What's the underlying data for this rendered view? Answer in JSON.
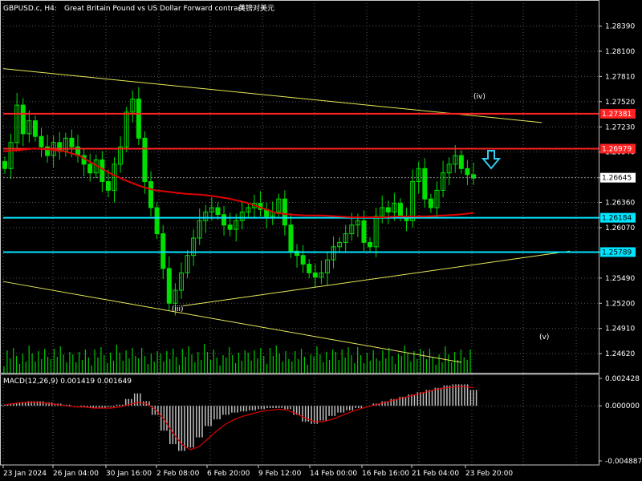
{
  "header": {
    "symbol_timeframe": "GBPUSD.c, H4:",
    "description": "Great Britain Pound vs US Dollar Forward contract",
    "description_cn": "英镑对美元"
  },
  "macd_label": "MACD(12,26,9) 0.001419 0.001649",
  "colors": {
    "background": "#000000",
    "grid": "#5a5a5a",
    "axis": "#c8c8c8",
    "candle": "#00e000",
    "volume": "#00c800",
    "ma_line": "#e00000",
    "resistance": "#ff2222",
    "support": "#00e5ff",
    "trendline": "#e8e85a",
    "macd_hist": "#c0c0c0",
    "macd_signal": "#e00000",
    "arrow": "#33ccee"
  },
  "chart_data": {
    "type": "candlestick",
    "symbol": "GBPUSD.c",
    "timeframe": "H4",
    "price_ylim": [
      1.244,
      1.2869
    ],
    "price_ticks": [
      "1.28390",
      "1.28100",
      "1.27810",
      "1.27520",
      "1.27230",
      "1.26940",
      "1.26645",
      "1.26360",
      "1.26184",
      "1.26070",
      "1.25789",
      "1.25490",
      "1.25200",
      "1.24910",
      "1.24620"
    ],
    "x_tick_labels": [
      "23 Jan 2024",
      "26 Jan 04:00",
      "30 Jan 16:00",
      "2 Feb 08:00",
      "6 Feb 20:00",
      "9 Feb 12:00",
      "14 Feb 00:00",
      "16 Feb 16:00",
      "21 Feb 04:00",
      "23 Feb 20:00"
    ],
    "close_series": [
      1.2675,
      1.2705,
      1.2748,
      1.2715,
      1.273,
      1.2712,
      1.27,
      1.269,
      1.2705,
      1.2695,
      1.271,
      1.27,
      1.269,
      1.268,
      1.267,
      1.2685,
      1.266,
      1.265,
      1.268,
      1.27,
      1.274,
      1.2755,
      1.271,
      1.266,
      1.263,
      1.26,
      1.256,
      1.252,
      1.2535,
      1.2555,
      1.2575,
      1.2595,
      1.2615,
      1.2625,
      1.263,
      1.2622,
      1.261,
      1.2605,
      1.2615,
      1.2625,
      1.263,
      1.2635,
      1.2628,
      1.262,
      1.2625,
      1.264,
      1.261,
      1.258,
      1.2575,
      1.2565,
      1.2555,
      1.255,
      1.2555,
      1.257,
      1.2585,
      1.259,
      1.26,
      1.261,
      1.2615,
      1.259,
      1.2585,
      1.262,
      1.263,
      1.2625,
      1.2635,
      1.262,
      1.2615,
      1.266,
      1.2675,
      1.264,
      1.263,
      1.265,
      1.267,
      1.268,
      1.269,
      1.2675,
      1.2668,
      1.2664
    ],
    "ma_series": [
      1.2695,
      1.2696,
      1.2698,
      1.2697,
      1.2695,
      1.269,
      1.268,
      1.267,
      1.2662,
      1.2655,
      1.265,
      1.2648,
      1.2646,
      1.2645,
      1.2643,
      1.264,
      1.2636,
      1.263,
      1.2624,
      1.2622,
      1.2621,
      1.2621,
      1.262,
      1.2619,
      1.2619,
      1.2619,
      1.262,
      1.262,
      1.262,
      1.2621,
      1.2622,
      1.2624
    ],
    "horizontal_levels": [
      {
        "name": "resistance",
        "value": 1.27381,
        "label": "1.27381"
      },
      {
        "name": "resistance",
        "value": 1.26979,
        "label": "1.26979"
      },
      {
        "name": "support",
        "value": 1.26184,
        "label": "1.26184"
      },
      {
        "name": "support",
        "value": 1.25789,
        "label": "1.25789"
      }
    ],
    "current_price": 1.26645,
    "current_price_label": "1.26645",
    "wave_labels": [
      "(iv)",
      "(iii)",
      "(v)"
    ],
    "macd": {
      "params": "12,26,9",
      "main": 0.001419,
      "signal": 0.001649,
      "ylim": [
        -0.004887,
        0.002428
      ],
      "ticks": [
        "0.002428",
        "0.000000",
        "-0.004887"
      ],
      "hist": [
        0.0001,
        0.0002,
        0.0003,
        0.0004,
        0.0004,
        0.0003,
        0.0002,
        0.0001,
        0.0,
        -0.0001,
        -0.0002,
        -0.0002,
        -0.0001,
        0.0001,
        0.0006,
        0.0011,
        0.0004,
        -0.0008,
        -0.0022,
        -0.0034,
        -0.004,
        -0.0037,
        -0.0028,
        -0.0018,
        -0.0012,
        -0.0008,
        -0.0006,
        -0.0005,
        -0.0004,
        -0.0003,
        -0.0002,
        -0.0002,
        -0.0003,
        -0.0008,
        -0.0014,
        -0.0016,
        -0.0013,
        -0.0009,
        -0.0006,
        -0.0004,
        -0.0002,
        0.0,
        0.0002,
        0.0004,
        0.0006,
        0.0008,
        0.001,
        0.0012,
        0.0014,
        0.0016,
        0.0018,
        0.0019,
        0.0019,
        0.0014
      ],
      "signal_series": [
        0.0001,
        0.0002,
        0.0003,
        0.0003,
        0.0003,
        0.0002,
        0.0001,
        0.0,
        -0.0001,
        -0.0001,
        -0.0002,
        -0.0002,
        -0.0002,
        -0.0001,
        0.0001,
        0.0003,
        0.0002,
        -0.0003,
        -0.0012,
        -0.0024,
        -0.0034,
        -0.0039,
        -0.0036,
        -0.0029,
        -0.0022,
        -0.0016,
        -0.0012,
        -0.0009,
        -0.0007,
        -0.0005,
        -0.0004,
        -0.0003,
        -0.0004,
        -0.0007,
        -0.0011,
        -0.0014,
        -0.0014,
        -0.0012,
        -0.0009,
        -0.0006,
        -0.0003,
        -0.0001,
        0.0001,
        0.0003,
        0.0005,
        0.0007,
        0.0009,
        0.0011,
        0.0013,
        0.0015,
        0.0016,
        0.0017,
        0.0017,
        0.0016
      ]
    }
  }
}
